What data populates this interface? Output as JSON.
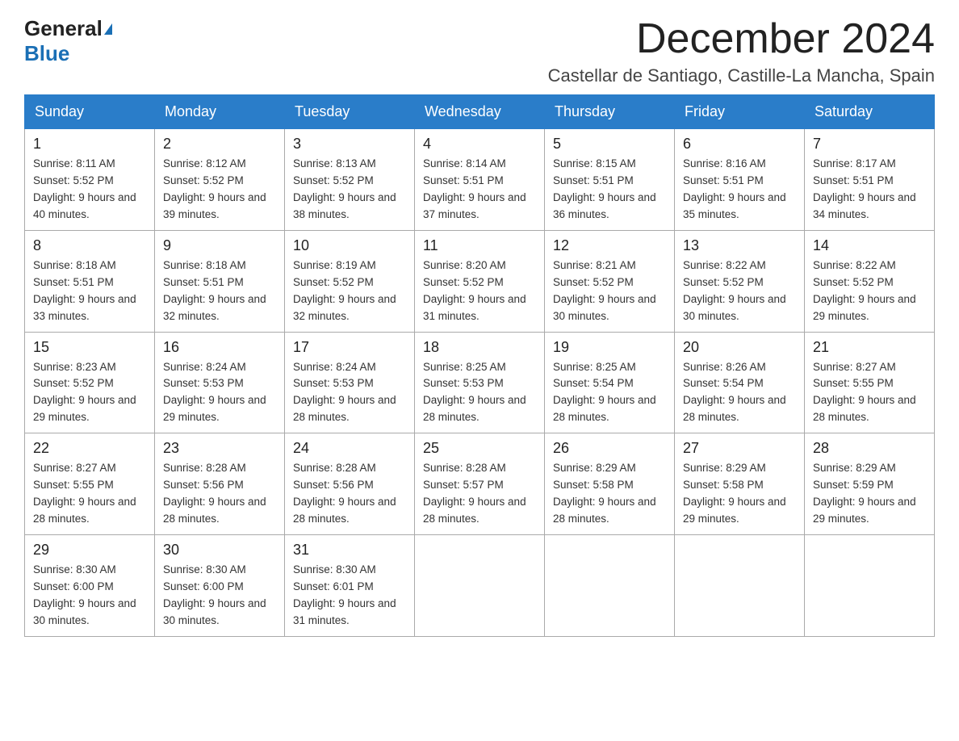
{
  "header": {
    "logo_general": "General",
    "logo_blue": "Blue",
    "month_title": "December 2024",
    "location": "Castellar de Santiago, Castille-La Mancha, Spain"
  },
  "weekdays": [
    "Sunday",
    "Monday",
    "Tuesday",
    "Wednesday",
    "Thursday",
    "Friday",
    "Saturday"
  ],
  "weeks": [
    [
      {
        "day": "1",
        "sunrise": "Sunrise: 8:11 AM",
        "sunset": "Sunset: 5:52 PM",
        "daylight": "Daylight: 9 hours and 40 minutes."
      },
      {
        "day": "2",
        "sunrise": "Sunrise: 8:12 AM",
        "sunset": "Sunset: 5:52 PM",
        "daylight": "Daylight: 9 hours and 39 minutes."
      },
      {
        "day": "3",
        "sunrise": "Sunrise: 8:13 AM",
        "sunset": "Sunset: 5:52 PM",
        "daylight": "Daylight: 9 hours and 38 minutes."
      },
      {
        "day": "4",
        "sunrise": "Sunrise: 8:14 AM",
        "sunset": "Sunset: 5:51 PM",
        "daylight": "Daylight: 9 hours and 37 minutes."
      },
      {
        "day": "5",
        "sunrise": "Sunrise: 8:15 AM",
        "sunset": "Sunset: 5:51 PM",
        "daylight": "Daylight: 9 hours and 36 minutes."
      },
      {
        "day": "6",
        "sunrise": "Sunrise: 8:16 AM",
        "sunset": "Sunset: 5:51 PM",
        "daylight": "Daylight: 9 hours and 35 minutes."
      },
      {
        "day": "7",
        "sunrise": "Sunrise: 8:17 AM",
        "sunset": "Sunset: 5:51 PM",
        "daylight": "Daylight: 9 hours and 34 minutes."
      }
    ],
    [
      {
        "day": "8",
        "sunrise": "Sunrise: 8:18 AM",
        "sunset": "Sunset: 5:51 PM",
        "daylight": "Daylight: 9 hours and 33 minutes."
      },
      {
        "day": "9",
        "sunrise": "Sunrise: 8:18 AM",
        "sunset": "Sunset: 5:51 PM",
        "daylight": "Daylight: 9 hours and 32 minutes."
      },
      {
        "day": "10",
        "sunrise": "Sunrise: 8:19 AM",
        "sunset": "Sunset: 5:52 PM",
        "daylight": "Daylight: 9 hours and 32 minutes."
      },
      {
        "day": "11",
        "sunrise": "Sunrise: 8:20 AM",
        "sunset": "Sunset: 5:52 PM",
        "daylight": "Daylight: 9 hours and 31 minutes."
      },
      {
        "day": "12",
        "sunrise": "Sunrise: 8:21 AM",
        "sunset": "Sunset: 5:52 PM",
        "daylight": "Daylight: 9 hours and 30 minutes."
      },
      {
        "day": "13",
        "sunrise": "Sunrise: 8:22 AM",
        "sunset": "Sunset: 5:52 PM",
        "daylight": "Daylight: 9 hours and 30 minutes."
      },
      {
        "day": "14",
        "sunrise": "Sunrise: 8:22 AM",
        "sunset": "Sunset: 5:52 PM",
        "daylight": "Daylight: 9 hours and 29 minutes."
      }
    ],
    [
      {
        "day": "15",
        "sunrise": "Sunrise: 8:23 AM",
        "sunset": "Sunset: 5:52 PM",
        "daylight": "Daylight: 9 hours and 29 minutes."
      },
      {
        "day": "16",
        "sunrise": "Sunrise: 8:24 AM",
        "sunset": "Sunset: 5:53 PM",
        "daylight": "Daylight: 9 hours and 29 minutes."
      },
      {
        "day": "17",
        "sunrise": "Sunrise: 8:24 AM",
        "sunset": "Sunset: 5:53 PM",
        "daylight": "Daylight: 9 hours and 28 minutes."
      },
      {
        "day": "18",
        "sunrise": "Sunrise: 8:25 AM",
        "sunset": "Sunset: 5:53 PM",
        "daylight": "Daylight: 9 hours and 28 minutes."
      },
      {
        "day": "19",
        "sunrise": "Sunrise: 8:25 AM",
        "sunset": "Sunset: 5:54 PM",
        "daylight": "Daylight: 9 hours and 28 minutes."
      },
      {
        "day": "20",
        "sunrise": "Sunrise: 8:26 AM",
        "sunset": "Sunset: 5:54 PM",
        "daylight": "Daylight: 9 hours and 28 minutes."
      },
      {
        "day": "21",
        "sunrise": "Sunrise: 8:27 AM",
        "sunset": "Sunset: 5:55 PM",
        "daylight": "Daylight: 9 hours and 28 minutes."
      }
    ],
    [
      {
        "day": "22",
        "sunrise": "Sunrise: 8:27 AM",
        "sunset": "Sunset: 5:55 PM",
        "daylight": "Daylight: 9 hours and 28 minutes."
      },
      {
        "day": "23",
        "sunrise": "Sunrise: 8:28 AM",
        "sunset": "Sunset: 5:56 PM",
        "daylight": "Daylight: 9 hours and 28 minutes."
      },
      {
        "day": "24",
        "sunrise": "Sunrise: 8:28 AM",
        "sunset": "Sunset: 5:56 PM",
        "daylight": "Daylight: 9 hours and 28 minutes."
      },
      {
        "day": "25",
        "sunrise": "Sunrise: 8:28 AM",
        "sunset": "Sunset: 5:57 PM",
        "daylight": "Daylight: 9 hours and 28 minutes."
      },
      {
        "day": "26",
        "sunrise": "Sunrise: 8:29 AM",
        "sunset": "Sunset: 5:58 PM",
        "daylight": "Daylight: 9 hours and 28 minutes."
      },
      {
        "day": "27",
        "sunrise": "Sunrise: 8:29 AM",
        "sunset": "Sunset: 5:58 PM",
        "daylight": "Daylight: 9 hours and 29 minutes."
      },
      {
        "day": "28",
        "sunrise": "Sunrise: 8:29 AM",
        "sunset": "Sunset: 5:59 PM",
        "daylight": "Daylight: 9 hours and 29 minutes."
      }
    ],
    [
      {
        "day": "29",
        "sunrise": "Sunrise: 8:30 AM",
        "sunset": "Sunset: 6:00 PM",
        "daylight": "Daylight: 9 hours and 30 minutes."
      },
      {
        "day": "30",
        "sunrise": "Sunrise: 8:30 AM",
        "sunset": "Sunset: 6:00 PM",
        "daylight": "Daylight: 9 hours and 30 minutes."
      },
      {
        "day": "31",
        "sunrise": "Sunrise: 8:30 AM",
        "sunset": "Sunset: 6:01 PM",
        "daylight": "Daylight: 9 hours and 31 minutes."
      },
      null,
      null,
      null,
      null
    ]
  ]
}
